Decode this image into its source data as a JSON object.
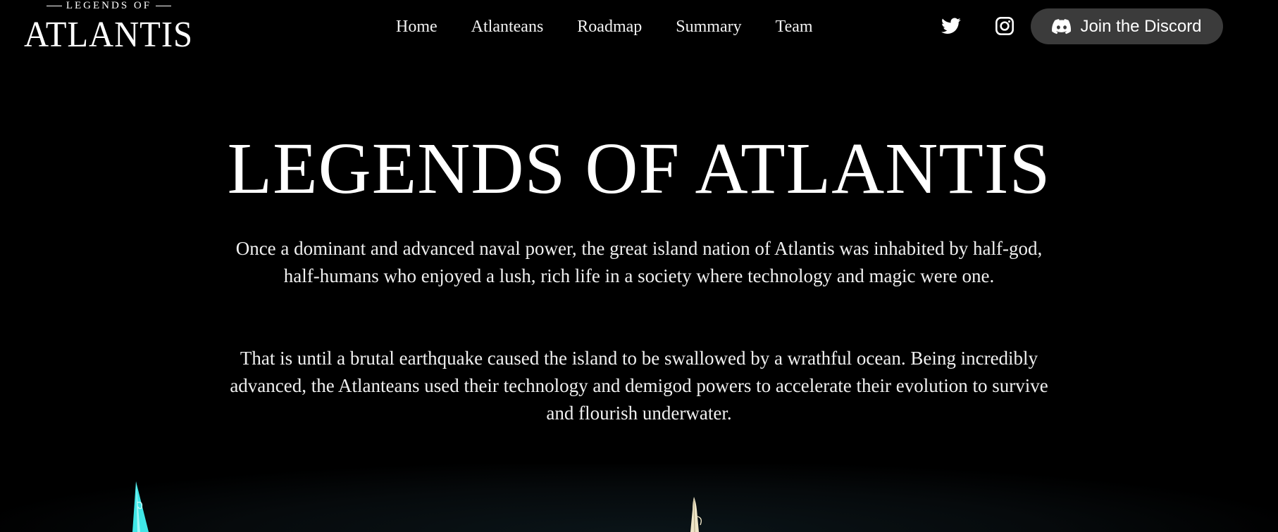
{
  "header": {
    "logo": {
      "top_text": "LEGENDS OF",
      "main_text": "ATLANTIS"
    },
    "nav": [
      {
        "label": "Home"
      },
      {
        "label": "Atlanteans"
      },
      {
        "label": "Roadmap"
      },
      {
        "label": "Summary"
      },
      {
        "label": "Team"
      }
    ],
    "social": {
      "twitter_icon": "twitter-icon",
      "instagram_icon": "instagram-icon"
    },
    "discord_button": {
      "label": "Join the Discord",
      "icon": "discord-icon",
      "bg_color": "#3b3b3b"
    }
  },
  "hero": {
    "title": "LEGENDS OF ATLANTIS",
    "paragraph_1": "Once a dominant and advanced naval power, the great island nation of Atlantis was inhabited by half-god, half-humans who enjoyed a lush, rich life in a society where technology and magic were one.",
    "paragraph_2": "That is until a brutal earthquake caused the island to be swallowed by a wrathful ocean. Being incredibly advanced, the Atlanteans used their technology and demigod powers to accelerate their evolution to survive and flourish underwater."
  },
  "colors": {
    "background": "#000000",
    "text": "#ffffff",
    "left_figure_accent": "#3fe6e6",
    "right_figure_accent": "#efe6c8"
  }
}
